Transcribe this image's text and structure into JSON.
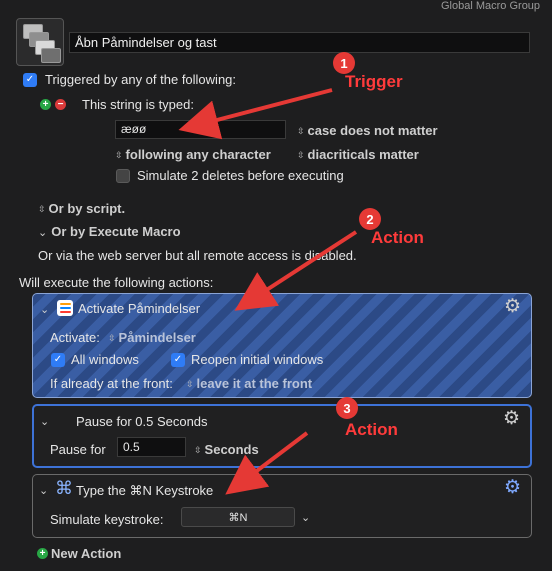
{
  "header": {
    "group_label": "Global Macro Group",
    "macro_name": "Åbn Påmindelser og tast"
  },
  "trigger": {
    "title": "Triggered by any of the following:",
    "string_label": "This string is typed:",
    "typed_value": "æøø",
    "case_option": "case does not matter",
    "following_option": "following any character",
    "diacriticals_option": "diacriticals matter",
    "simulate_label": "Simulate 2 deletes before executing",
    "or_by_script": "Or by script.",
    "or_by_execute": "Or by Execute Macro",
    "web_server_text": "Or via the web server but all remote access is disabled."
  },
  "annotations": {
    "badge1": "1",
    "label1": "Trigger",
    "badge2": "2",
    "label2": "Action",
    "badge3": "3",
    "label3": "Action",
    "arrow_color": "#e53935"
  },
  "actions_title": "Will execute the following actions:",
  "action1": {
    "title": "Activate Påmindelser",
    "activate_label": "Activate:",
    "activate_value": "Påmindelser",
    "all_windows": "All windows",
    "reopen": "Reopen initial windows",
    "front_label": "If already at the front:",
    "front_value": "leave it at the front",
    "icon": "reminders-icon"
  },
  "action2": {
    "title": "Pause for 0.5 Seconds",
    "pause_label": "Pause for",
    "pause_value": "0.5",
    "unit": "Seconds"
  },
  "action3": {
    "title": "Type the ⌘N Keystroke",
    "simulate_label": "Simulate keystroke:",
    "keystroke": "⌘N",
    "icon": "command-icon"
  },
  "new_action": "New Action",
  "colors": {
    "accent": "#2f7cf6",
    "selected_border": "#3d72d7",
    "annotation": "#e53935"
  }
}
